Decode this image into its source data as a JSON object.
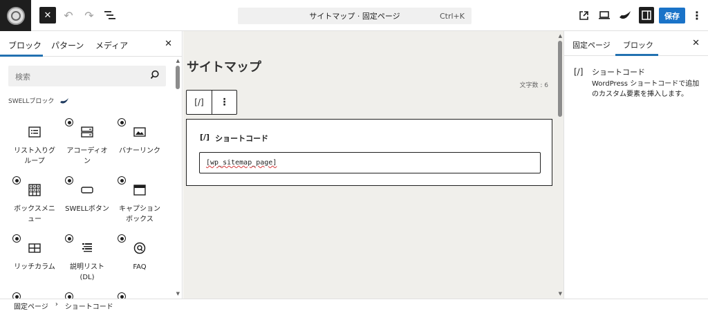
{
  "topbar": {
    "close_icon": "close-icon",
    "command_title": "サイトマップ · 固定ページ",
    "command_shortcut": "Ctrl+K",
    "save_label": "保存"
  },
  "inserter": {
    "tabs": [
      "ブロック",
      "パターン",
      "メディア"
    ],
    "search_placeholder": "検索",
    "category": "SWELLブロック",
    "blocks": [
      {
        "label": "リスト入りグ\nループ",
        "icon": "list-group-icon",
        "badge": false
      },
      {
        "label": "アコーディオ\nン",
        "icon": "accordion-icon",
        "badge": true
      },
      {
        "label": "バナーリンク",
        "icon": "banner-link-icon",
        "badge": true
      },
      {
        "label": "ボックスメニ\nュー",
        "icon": "box-menu-icon",
        "badge": true
      },
      {
        "label": "SWELLボタン",
        "icon": "button-icon",
        "badge": true
      },
      {
        "label": "キャプション\nボックス",
        "icon": "caption-box-icon",
        "badge": true
      },
      {
        "label": "リッチカラム",
        "icon": "rich-column-icon",
        "badge": true
      },
      {
        "label": "説明リスト\n(DL)",
        "icon": "description-list-icon",
        "badge": true
      },
      {
        "label": "FAQ",
        "icon": "faq-icon",
        "badge": true
      }
    ]
  },
  "canvas": {
    "page_title": "サイトマップ",
    "char_count": "文字数 : 6",
    "toolbar_block_icon": "[/]",
    "shortcode_heading_icon": "[/]",
    "shortcode_heading": "ショートコード",
    "shortcode_value": "[wp_sitemap_page]"
  },
  "settings": {
    "tabs": [
      "固定ページ",
      "ブロック"
    ],
    "block_icon": "[/]",
    "block_title": "ショートコード",
    "block_desc": "WordPress ショートコードで追加のカスタム要素を挿入します。"
  },
  "breadcrumb": [
    "固定ページ",
    "ショートコード"
  ],
  "colors": {
    "accent": "#2271b1",
    "save": "#1a73c8",
    "canvas_bg": "#f0efeb"
  }
}
